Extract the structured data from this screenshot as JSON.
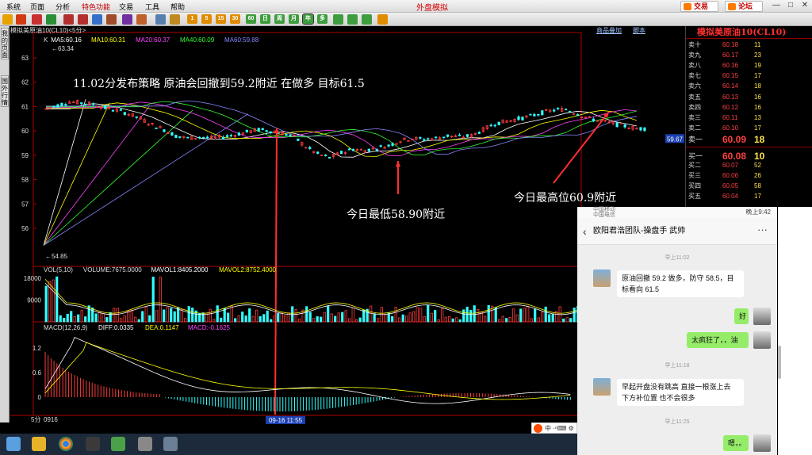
{
  "menu": {
    "items": [
      "系统",
      "页面",
      "分析",
      "特色功能",
      "交易",
      "工具",
      "帮助"
    ],
    "title": "外盘模拟",
    "trade_label": "交易",
    "forum_label": "论坛",
    "win_controls": [
      "—",
      "□",
      "✕"
    ]
  },
  "toolbar": {
    "period_buttons": [
      "1",
      "5",
      "15",
      "30",
      "60",
      "日",
      "周",
      "月",
      "年",
      "多"
    ]
  },
  "side_tabs": [
    "我的页面",
    "国外行情"
  ],
  "chart": {
    "title": "模拟美原油10(CL10)<5分>",
    "links": [
      "商品叠加",
      "脚本"
    ],
    "ma_legend": [
      {
        "text": "K",
        "color": "#dddddd"
      },
      {
        "text": "MA5:60.16",
        "color": "#ffffff"
      },
      {
        "text": "MA10:60.31",
        "color": "#ffff00"
      },
      {
        "text": "MA20:60.37",
        "color": "#ff44ff"
      },
      {
        "text": "MA40:60.09",
        "color": "#33ff33"
      },
      {
        "text": "MA60:59.88",
        "color": "#8888ff"
      }
    ],
    "price_ticks": [
      "63",
      "62",
      "61",
      "60",
      "59",
      "58",
      "57",
      "56"
    ],
    "high_mark": "63.34",
    "low_mark": "54.85",
    "last_price": "59.67",
    "vol_legend": [
      {
        "text": "VOL(5,10)",
        "color": "#dddddd"
      },
      {
        "text": "VOLUME:7675.0000",
        "color": "#dddddd"
      },
      {
        "text": "MAVOL1:8405.2000",
        "color": "#ffffff"
      },
      {
        "text": "MAVOL2:8752.4000",
        "color": "#ffff00"
      }
    ],
    "vol_ticks": [
      "18000",
      "9000"
    ],
    "macd_legend": [
      {
        "text": "MACD(12,26,9)",
        "color": "#dddddd"
      },
      {
        "text": "DIFF:0.0335",
        "color": "#ffffff"
      },
      {
        "text": "DEA:0.1147",
        "color": "#ffff00"
      },
      {
        "text": "MACD:-0.1625",
        "color": "#ff44ff"
      }
    ],
    "macd_ticks": [
      "1.2",
      "0.6",
      "0"
    ],
    "period_label": "5分",
    "date_label": "0916",
    "cursor_time": "09-16 11:55",
    "annotations": {
      "strategy": "11.02分发布策略 原油会回撤到59.2附近 在做多 目标61.5",
      "low": "今日最低58.90附近",
      "high": "今日最高位60.9附近"
    }
  },
  "quote": {
    "title": "模拟美原油10(CL10)",
    "asks": [
      {
        "label": "卖十",
        "price": "60.18",
        "vol": "11"
      },
      {
        "label": "卖九",
        "price": "60.17",
        "vol": "23"
      },
      {
        "label": "卖八",
        "price": "60.16",
        "vol": "19"
      },
      {
        "label": "卖七",
        "price": "60.15",
        "vol": "17"
      },
      {
        "label": "卖六",
        "price": "60.14",
        "vol": "18"
      },
      {
        "label": "卖五",
        "price": "60.13",
        "vol": "16"
      },
      {
        "label": "卖四",
        "price": "60.12",
        "vol": "16"
      },
      {
        "label": "卖三",
        "price": "60.11",
        "vol": "13"
      },
      {
        "label": "卖二",
        "price": "60.10",
        "vol": "17"
      },
      {
        "label": "卖一",
        "price": "60.09",
        "vol": "18"
      }
    ],
    "bids": [
      {
        "label": "买一",
        "price": "60.08",
        "vol": "10"
      },
      {
        "label": "买二",
        "price": "60.07",
        "vol": "52"
      },
      {
        "label": "买三",
        "price": "60.06",
        "vol": "26"
      },
      {
        "label": "买四",
        "price": "60.05",
        "vol": "58"
      },
      {
        "label": "买五",
        "price": "60.04",
        "vol": "17"
      }
    ]
  },
  "phone": {
    "carrier": "中国移动",
    "carrier2": "中国电信",
    "time": "晚上9:42",
    "chat_title": "欧阳君浩团队-操盘手 武帅",
    "messages": [
      {
        "kind": "time",
        "text": "早上11:02"
      },
      {
        "kind": "left",
        "text": "原油回撤 59.2 做多，防守 58.5，目标看向 61.5"
      },
      {
        "kind": "right",
        "text": "好"
      },
      {
        "kind": "right",
        "text": "太疯狂了，，油"
      },
      {
        "kind": "time",
        "text": "早上11:18"
      },
      {
        "kind": "left",
        "text": "早起开盘没有跳高 直接一根涨上去 下方补位置 也不会很多"
      },
      {
        "kind": "time",
        "text": "早上11:25"
      },
      {
        "kind": "right",
        "text": "嗯，。"
      }
    ]
  },
  "taskbar": {
    "ime_label": "中"
  },
  "chart_data": {
    "type": "candlestick",
    "price_axis": {
      "ticks": [
        63,
        62,
        61,
        60,
        59,
        58,
        57,
        56
      ],
      "high": 63.34,
      "low": 54.85,
      "last": 59.67
    },
    "price_path": [
      60.9,
      61.05,
      61.2,
      61.15,
      61.1,
      60.95,
      60.85,
      60.7,
      60.5,
      60.25,
      60.05,
      59.8,
      59.7,
      59.75,
      59.7,
      59.75,
      59.85,
      59.95,
      60.05,
      60.0,
      59.9,
      59.75,
      59.35,
      59.05,
      58.9,
      59.1,
      59.25,
      59.2,
      59.3,
      59.4,
      59.6,
      59.7,
      59.65,
      59.7,
      59.8,
      59.75,
      59.8,
      60.05,
      60.3,
      60.4,
      60.5,
      60.6,
      60.75,
      60.85,
      60.9,
      60.7,
      60.5,
      60.4,
      60.3,
      60.2,
      60.1
    ],
    "ma_values": {
      "MA5": 60.16,
      "MA10": 60.31,
      "MA20": 60.37,
      "MA40": 60.09,
      "MA60": 59.88
    },
    "volume": {
      "ticks": [
        18000,
        9000
      ],
      "VOLUME": 7675,
      "MAVOL1": 8405.2,
      "MAVOL2": 8752.4
    },
    "macd": {
      "ticks": [
        1.2,
        0.6,
        0
      ],
      "DIFF": 0.0335,
      "DEA": 0.1147,
      "MACD": -0.1625
    }
  }
}
